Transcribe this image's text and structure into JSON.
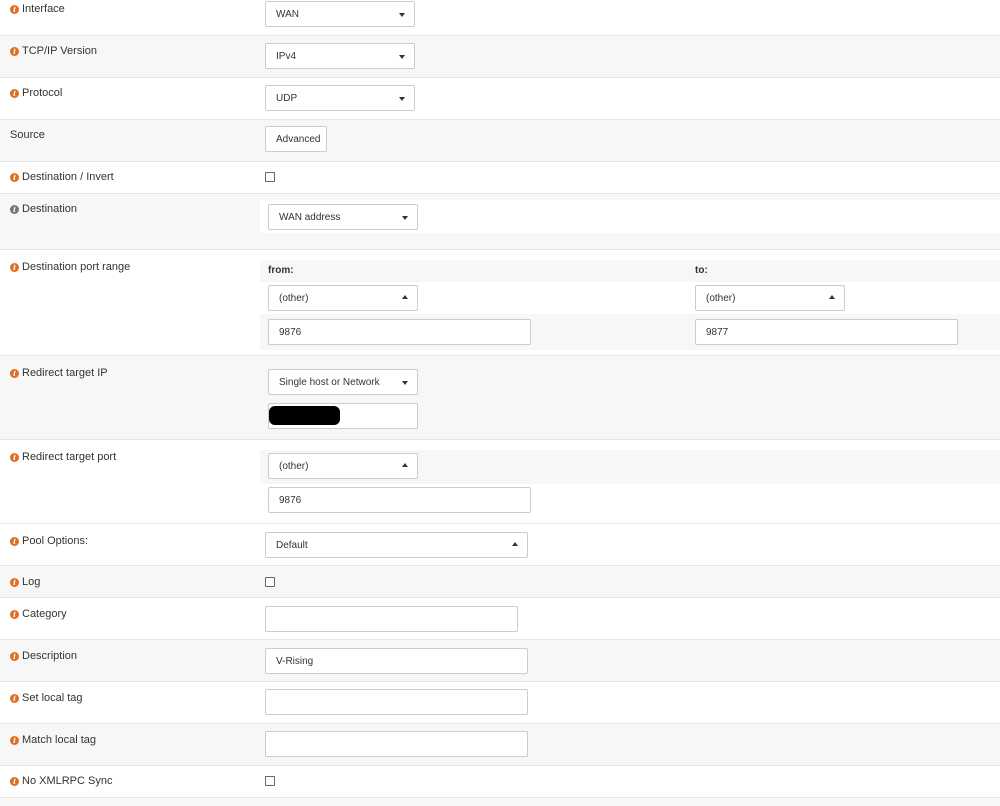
{
  "form": {
    "interface": {
      "label": "Interface",
      "value": "WAN"
    },
    "ip_version": {
      "label": "TCP/IP Version",
      "value": "IPv4"
    },
    "protocol": {
      "label": "Protocol",
      "value": "UDP"
    },
    "source": {
      "label": "Source",
      "button": "Advanced"
    },
    "dest_invert": {
      "label": "Destination / Invert",
      "checked": false
    },
    "destination": {
      "label": "Destination",
      "value": "WAN address"
    },
    "dest_port_range": {
      "label": "Destination port range",
      "from_label": "from:",
      "to_label": "to:",
      "from_select": "(other)",
      "to_select": "(other)",
      "from_value": "9876",
      "to_value": "9877"
    },
    "redirect_ip": {
      "label": "Redirect target IP",
      "value": "Single host or Network",
      "ip": ""
    },
    "redirect_port": {
      "label": "Redirect target port",
      "select": "(other)",
      "value": "9876"
    },
    "pool_options": {
      "label": "Pool Options:",
      "value": "Default"
    },
    "log": {
      "label": "Log",
      "checked": false
    },
    "category": {
      "label": "Category",
      "value": ""
    },
    "description": {
      "label": "Description",
      "value": "V-Rising"
    },
    "set_local_tag": {
      "label": "Set local tag",
      "value": ""
    },
    "match_local_tag": {
      "label": "Match local tag",
      "value": ""
    },
    "no_xmlrpc_sync": {
      "label": "No XMLRPC Sync",
      "checked": false
    }
  },
  "colors": {
    "info_orange": "#e06f1d",
    "info_gray": "#767676",
    "row_alt": "#f7f7f7"
  },
  "icons": {
    "info": "info-circle-icon",
    "select": "chevron-down-icon"
  }
}
